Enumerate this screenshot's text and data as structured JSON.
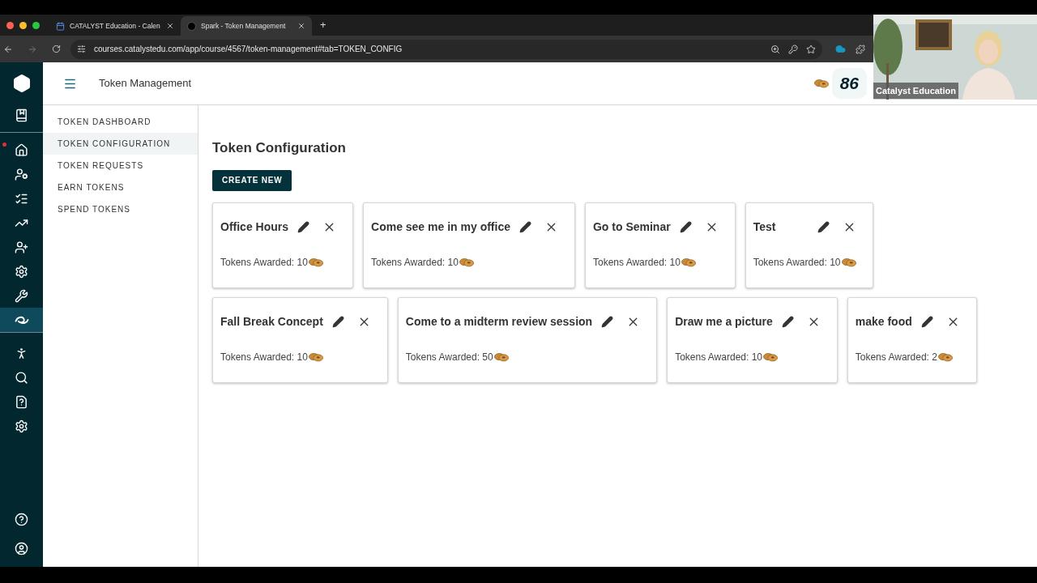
{
  "browser": {
    "tabs": [
      {
        "title": "CATALYST Education - Calen",
        "selected": false
      },
      {
        "title": "Spark - Token Management",
        "selected": true
      }
    ],
    "new_tab": "+",
    "url": "courses.catalystedu.com/app/course/4567/token-management#tab=TOKEN_CONFIG"
  },
  "video": {
    "caption": "Catalyst Education"
  },
  "rail": {
    "top": [
      {
        "kind": "logo",
        "selected": false,
        "notification": false
      },
      {
        "kind": "book",
        "selected": false,
        "notification": false
      }
    ],
    "items": [
      {
        "kind": "home",
        "selected": false,
        "notification": true
      },
      {
        "kind": "user-gear",
        "selected": false,
        "notification": false
      },
      {
        "kind": "list",
        "selected": false,
        "notification": false
      },
      {
        "kind": "trend",
        "selected": false,
        "notification": false
      },
      {
        "kind": "user-plus",
        "selected": false,
        "notification": false
      },
      {
        "kind": "gear",
        "selected": false,
        "notification": false
      },
      {
        "kind": "tools",
        "selected": false,
        "notification": false
      },
      {
        "kind": "token",
        "selected": true,
        "notification": false
      }
    ],
    "lower": [
      {
        "kind": "hiker",
        "selected": false,
        "notification": false
      },
      {
        "kind": "search",
        "selected": false,
        "notification": false
      },
      {
        "kind": "quiz",
        "selected": false,
        "notification": false
      },
      {
        "kind": "cog-box",
        "selected": false,
        "notification": false
      }
    ],
    "bottom": [
      {
        "kind": "help",
        "selected": false,
        "notification": false
      },
      {
        "kind": "account",
        "selected": false,
        "notification": false
      }
    ]
  },
  "header": {
    "title": "Token Management",
    "token_count": "86"
  },
  "nav": [
    {
      "label": "TOKEN DASHBOARD",
      "selected": false
    },
    {
      "label": "TOKEN CONFIGURATION",
      "selected": true
    },
    {
      "label": "TOKEN REQUESTS",
      "selected": false
    },
    {
      "label": "EARN TOKENS",
      "selected": false
    },
    {
      "label": "SPEND TOKENS",
      "selected": false
    }
  ],
  "page_title": "Token Configuration",
  "create_button": "CREATE NEW",
  "card_rows": [
    [
      {
        "title": "Office Hours",
        "awarded": "Tokens Awarded: 10"
      },
      {
        "title": "Come see me in my office",
        "awarded": "Tokens Awarded: 10"
      },
      {
        "title": "Go to Seminar",
        "awarded": "Tokens Awarded: 10"
      },
      {
        "title": "Test",
        "awarded": "Tokens Awarded: 10"
      }
    ],
    [
      {
        "title": "Fall Break Concept",
        "awarded": "Tokens Awarded: 10"
      },
      {
        "title": "Come to a midterm review session",
        "awarded": "Tokens Awarded: 50"
      },
      {
        "title": "Draw me a picture",
        "awarded": "Tokens Awarded: 10"
      },
      {
        "title": "make food",
        "awarded": "Tokens Awarded: 2"
      }
    ]
  ]
}
